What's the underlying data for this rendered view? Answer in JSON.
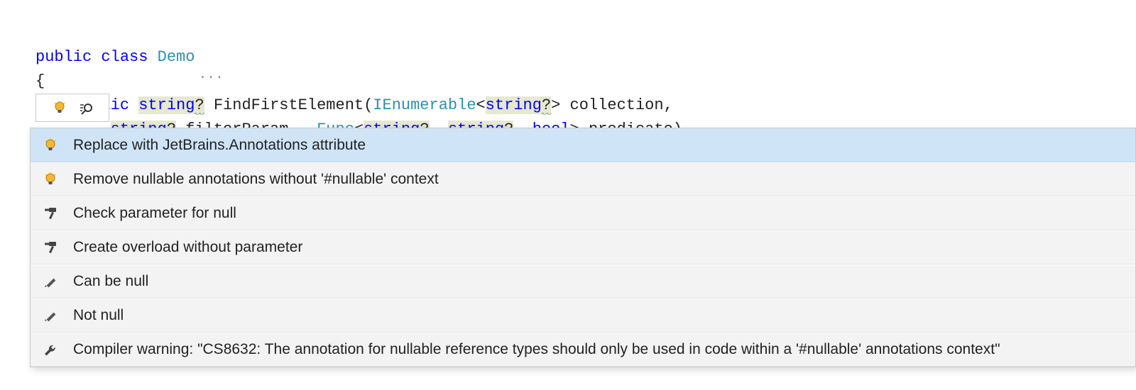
{
  "code": {
    "line1": {
      "kw_public": "public",
      "kw_class": "class",
      "cls_name": "Demo"
    },
    "line2": {
      "brace": "{"
    },
    "line3": {
      "kw_public": "public",
      "t_string": "string",
      "q1": "?",
      "method": "FindFirstElement",
      "lpar": "(",
      "t_ienum": "IEnumerable",
      "lt": "<",
      "t_string2": "string",
      "q2": "?",
      "gt": ">",
      "param1": " collection,"
    },
    "line4": {
      "t_string": "string",
      "q1": "?",
      "param1": " filterParam,  ",
      "t_func": "Func",
      "lt": "<",
      "t_string2": "string",
      "q2": "?",
      "comma1": ", ",
      "t_string3": "string",
      "q3": "?",
      "comma2": ", ",
      "t_bool": "bool",
      "gt": ">",
      "param2": " predicate)"
    },
    "dots": "..."
  },
  "popup": {
    "items": [
      {
        "icon": "bulb",
        "label": "Replace with JetBrains.Annotations attribute",
        "selected": true
      },
      {
        "icon": "bulb",
        "label": "Remove nullable annotations without '#nullable' context"
      },
      {
        "icon": "hammer",
        "label": "Check parameter for null"
      },
      {
        "icon": "hammer",
        "label": "Create overload without parameter"
      },
      {
        "icon": "pencil",
        "label": "Can be null"
      },
      {
        "icon": "pencil",
        "label": "Not null"
      },
      {
        "icon": "wrench",
        "label": "Compiler warning: \"CS8632: The annotation for nullable reference types should only be used in code within a '#nullable' annotations context\""
      }
    ]
  }
}
